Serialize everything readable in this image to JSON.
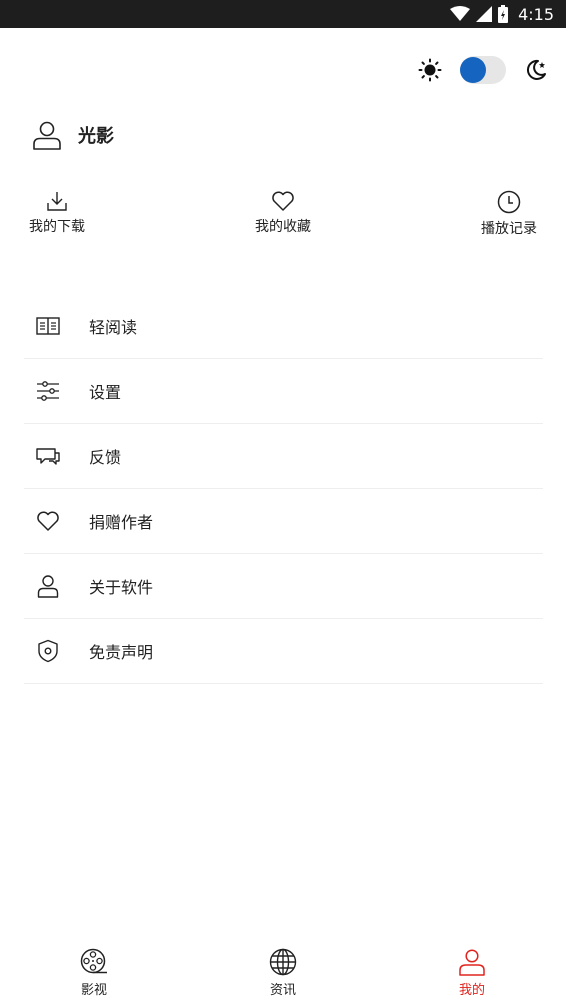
{
  "status_bar": {
    "time": "4:15"
  },
  "profile": {
    "name": "光影"
  },
  "quick_actions": [
    {
      "label": "我的下载",
      "icon": "download-icon"
    },
    {
      "label": "我的收藏",
      "icon": "heart-icon"
    },
    {
      "label": "播放记录",
      "icon": "clock-icon"
    }
  ],
  "menu": [
    {
      "label": "轻阅读",
      "icon": "book-icon"
    },
    {
      "label": "设置",
      "icon": "sliders-icon"
    },
    {
      "label": "反馈",
      "icon": "feedback-icon"
    },
    {
      "label": "捐赠作者",
      "icon": "heart-icon"
    },
    {
      "label": "关于软件",
      "icon": "user-icon"
    },
    {
      "label": "免责声明",
      "icon": "shield-icon"
    }
  ],
  "bottom_nav": [
    {
      "label": "影视",
      "icon": "film-reel-icon",
      "active": false
    },
    {
      "label": "资讯",
      "icon": "globe-icon",
      "active": false
    },
    {
      "label": "我的",
      "icon": "user-icon",
      "active": true
    }
  ],
  "colors": {
    "accent": "#1565c0",
    "active_nav": "#e0231e",
    "status_bar": "#1e1e1e"
  }
}
